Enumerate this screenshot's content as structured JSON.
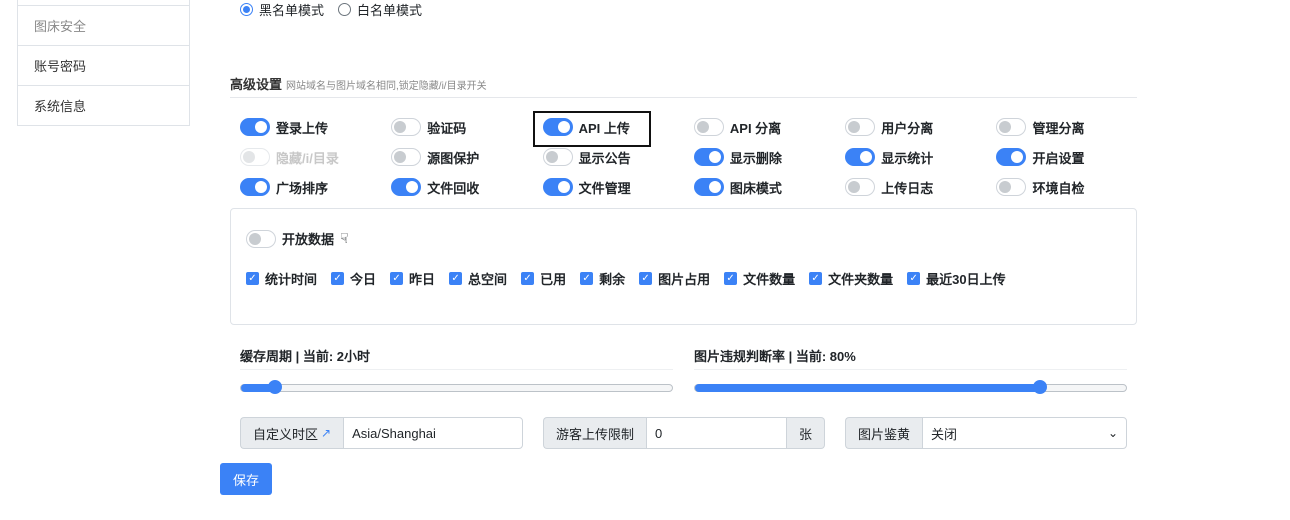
{
  "sidebar": {
    "items": [
      {
        "label": ""
      },
      {
        "label": "图床安全"
      },
      {
        "label": "账号密码"
      },
      {
        "label": "系统信息"
      }
    ]
  },
  "mode": {
    "blacklist_label": "黑名单模式",
    "whitelist_label": "白名单模式",
    "selected": "黑名单模式"
  },
  "advanced": {
    "title": "高级设置",
    "subtitle": "网站域名与图片域名相同,锁定隐藏/i/目录开关"
  },
  "switches": [
    {
      "label": "登录上传",
      "on": true
    },
    {
      "label": "验证码",
      "on": false
    },
    {
      "label": "API 上传",
      "on": true
    },
    {
      "label": "API 分离",
      "on": false
    },
    {
      "label": "用户分离",
      "on": false
    },
    {
      "label": "管理分离",
      "on": false
    },
    {
      "label": "隐藏/i/目录",
      "on": false,
      "disabled": true
    },
    {
      "label": "源图保护",
      "on": false
    },
    {
      "label": "显示公告",
      "on": false
    },
    {
      "label": "显示删除",
      "on": true
    },
    {
      "label": "显示统计",
      "on": true
    },
    {
      "label": "开启设置",
      "on": true
    },
    {
      "label": "广场排序",
      "on": true
    },
    {
      "label": "文件回收",
      "on": true
    },
    {
      "label": "文件管理",
      "on": true
    },
    {
      "label": "图床模式",
      "on": true
    },
    {
      "label": "上传日志",
      "on": false
    },
    {
      "label": "环境自检",
      "on": false
    }
  ],
  "open_data": {
    "label": "开放数据",
    "on": false,
    "icon": "hand-pointer-icon",
    "checks": [
      {
        "label": "统计时间",
        "checked": true
      },
      {
        "label": "今日",
        "checked": true
      },
      {
        "label": "昨日",
        "checked": true
      },
      {
        "label": "总空间",
        "checked": true
      },
      {
        "label": "已用",
        "checked": true
      },
      {
        "label": "剩余",
        "checked": true
      },
      {
        "label": "图片占用",
        "checked": true
      },
      {
        "label": "文件数量",
        "checked": true
      },
      {
        "label": "文件夹数量",
        "checked": true
      },
      {
        "label": "最近30日上传",
        "checked": true
      }
    ]
  },
  "cache": {
    "label": "缓存周期 | 当前: 2小时",
    "value_fraction": 0.08
  },
  "violation": {
    "label": "图片违规判断率 | 当前: 80%",
    "value_fraction": 0.8
  },
  "timezone": {
    "label": "自定义时区",
    "value": "Asia/Shanghai"
  },
  "guest_limit": {
    "label": "游客上传限制",
    "value": "0",
    "unit": "张"
  },
  "nsfw": {
    "label": "图片鉴黄",
    "value": "关闭"
  },
  "save_label": "保存",
  "colors": {
    "accent": "#3b82f6"
  }
}
